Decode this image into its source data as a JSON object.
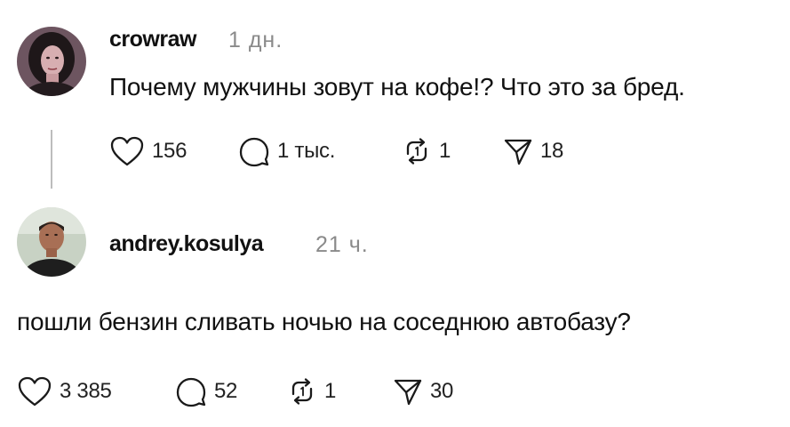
{
  "posts": [
    {
      "username": "crowraw",
      "time": "1 дн.",
      "text": "Почему мужчины зовут на кофе!? Что это за бред.",
      "likes": "156",
      "replies": "1 тыс.",
      "reposts": "1",
      "shares": "18"
    },
    {
      "username": "andrey.kosulya",
      "time": "21 ч.",
      "text": "пошли бензин сливать ночью на соседнюю автобазу?",
      "likes": "3 385",
      "replies": "52",
      "reposts": "1",
      "shares": "30"
    }
  ],
  "icons": {
    "like": "heart-icon",
    "reply": "comment-icon",
    "repost": "repost-icon",
    "share": "send-icon"
  },
  "colors": {
    "text": "#111111",
    "muted": "#8a8a8a",
    "thread_line": "#bdbdbd"
  }
}
